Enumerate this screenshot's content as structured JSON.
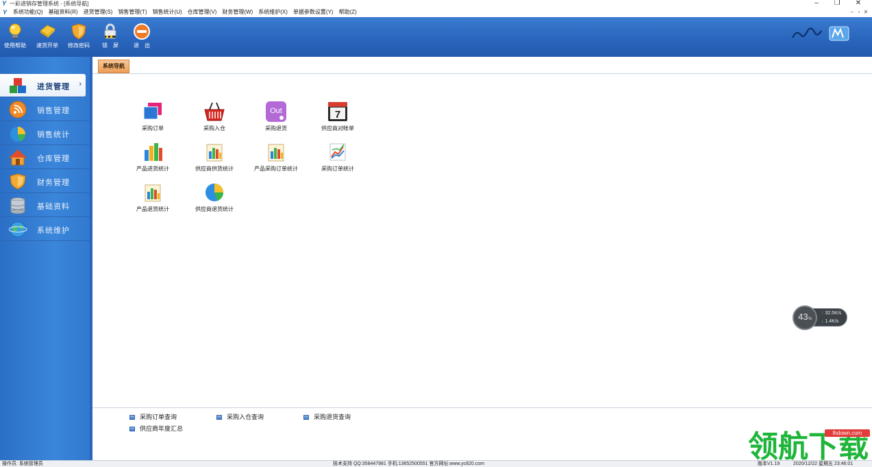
{
  "window": {
    "title": "一彩进销存管理系统 - [系统导航]",
    "minimize": "–",
    "maximize": "❐",
    "close": "✕"
  },
  "menu": {
    "items": [
      "系统功能(Q)",
      "基础资料(R)",
      "进货管理(S)",
      "销售管理(T)",
      "销售统计(U)",
      "仓库管理(V)",
      "财务管理(W)",
      "系统维护(X)",
      "单据参数设置(Y)",
      "帮助(Z)"
    ],
    "mdi_controls": [
      "–",
      "▫",
      "✕"
    ]
  },
  "toolbar": {
    "help": "使用帮助",
    "quick_order": "速货开单",
    "change_password": "修改密码",
    "lock": "锁　屏",
    "exit": "退　出"
  },
  "sidebar": {
    "items": [
      {
        "label": "进货管理",
        "icon": "blocks-icon"
      },
      {
        "label": "销售管理",
        "icon": "rss-icon"
      },
      {
        "label": "销售统计",
        "icon": "pie-chart-icon"
      },
      {
        "label": "仓库管理",
        "icon": "house-icon"
      },
      {
        "label": "财务管理",
        "icon": "shield-icon"
      },
      {
        "label": "基础资料",
        "icon": "database-icon"
      },
      {
        "label": "系统维护",
        "icon": "globe-icon"
      }
    ],
    "active_chevron": "›"
  },
  "tabs": {
    "active": "系统导航"
  },
  "nav_tiles": [
    {
      "label": "采购订单",
      "icon": "purchase-order-icon"
    },
    {
      "label": "采购入仓",
      "icon": "basket-icon"
    },
    {
      "label": "采购退货",
      "icon": "out-icon"
    },
    {
      "label": "供应商对帐单",
      "icon": "calendar-icon"
    },
    {
      "label": "产品进货统计",
      "icon": "bar-chart-icon"
    },
    {
      "label": "供应商供货统计",
      "icon": "book-chart-icon"
    },
    {
      "label": "产品采购订单统计",
      "icon": "book-chart-icon"
    },
    {
      "label": "采购订单统计",
      "icon": "line-chart-icon"
    },
    {
      "label": "产品退货统计",
      "icon": "book-chart-icon"
    },
    {
      "label": "供应商退货统计",
      "icon": "pie-chart-icon"
    }
  ],
  "out_icon_text": "Out",
  "calendar_day": "7",
  "quick_links": [
    "采购订单查询",
    "采购入仓查询",
    "采购退货查询",
    "供应商年度汇总"
  ],
  "net_widget": {
    "percent": "43",
    "percent_unit": "%",
    "upload": "32.5",
    "upload_unit": "K/s",
    "download": "1.4",
    "download_unit": "K/s",
    "up_arrow": "↑",
    "down_arrow": "↓"
  },
  "watermark": {
    "domain": "lhdown.com",
    "brand": "领航下载"
  },
  "status": {
    "operator": "操作员: 系统管理员",
    "support": "技术支持 QQ:358447981 手机:13652500551 官方网址:www.yc820.com",
    "version": "版本V1.19",
    "datetime": "2020/12/22 星期五 23:46:01"
  },
  "colors": {
    "toolbar_blue": "#2a66bd",
    "sidebar_blue": "#3179cf",
    "tab_orange": "#ec9c55",
    "watermark_green": "#1fb53a"
  }
}
